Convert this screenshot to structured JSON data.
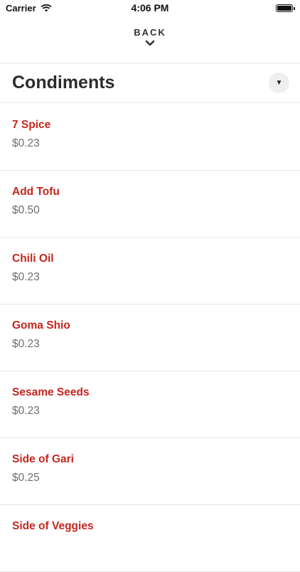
{
  "status_bar": {
    "carrier": "Carrier",
    "time": "4:06 PM"
  },
  "header": {
    "back_label": "BACK"
  },
  "section": {
    "title": "Condiments"
  },
  "items": [
    {
      "name": "7 Spice",
      "price": "$0.23"
    },
    {
      "name": "Add Tofu",
      "price": "$0.50"
    },
    {
      "name": "Chili Oil",
      "price": "$0.23"
    },
    {
      "name": "Goma Shio",
      "price": "$0.23"
    },
    {
      "name": "Sesame Seeds",
      "price": "$0.23"
    },
    {
      "name": "Side of Gari",
      "price": "$0.25"
    },
    {
      "name": "Side of Veggies",
      "price": ""
    }
  ],
  "colors": {
    "accent": "#c4261c",
    "price": "#6e6e6e",
    "divider": "#e6e6e6"
  }
}
